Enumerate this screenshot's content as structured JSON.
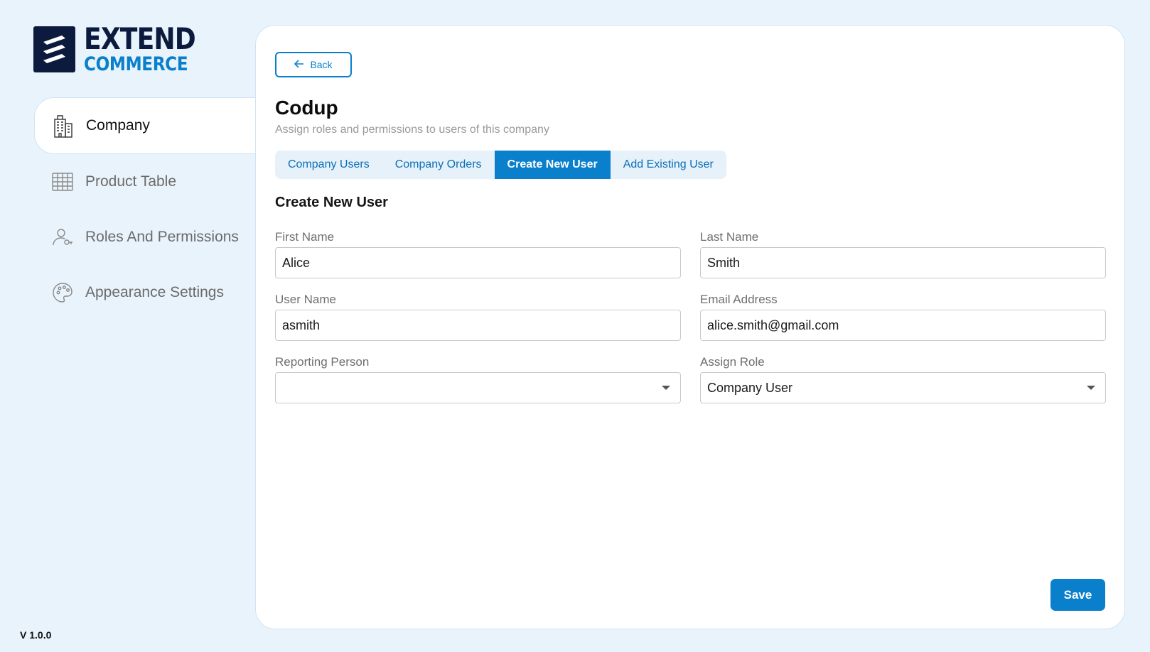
{
  "brand": {
    "word_top": "EXTEND",
    "word_bottom": "COMMERCE",
    "primary_color": "#0c1b3d",
    "accent_color": "#0a7fcc"
  },
  "sidebar": {
    "items": [
      {
        "label": "Company",
        "icon": "building-icon",
        "active": true
      },
      {
        "label": "Product Table",
        "icon": "table-grid-icon",
        "active": false
      },
      {
        "label": "Roles And Permissions",
        "icon": "user-key-icon",
        "active": false
      },
      {
        "label": "Appearance Settings",
        "icon": "palette-icon",
        "active": false
      }
    ],
    "version": "V 1.0.0"
  },
  "header": {
    "back_label": "Back",
    "title": "Codup",
    "subtitle": "Assign roles and permissions to users of this company"
  },
  "tabs": [
    {
      "label": "Company Users",
      "active": false
    },
    {
      "label": "Company Orders",
      "active": false
    },
    {
      "label": "Create New User",
      "active": true
    },
    {
      "label": "Add Existing User",
      "active": false
    }
  ],
  "form": {
    "section_title": "Create New User",
    "first_name": {
      "label": "First Name",
      "value": "Alice"
    },
    "last_name": {
      "label": "Last Name",
      "value": "Smith"
    },
    "user_name": {
      "label": "User Name",
      "value": "asmith"
    },
    "email": {
      "label": "Email Address",
      "value": "alice.smith@gmail.com"
    },
    "reporting_person": {
      "label": "Reporting Person",
      "value": ""
    },
    "assign_role": {
      "label": "Assign Role",
      "value": "Company User"
    },
    "save_label": "Save"
  }
}
